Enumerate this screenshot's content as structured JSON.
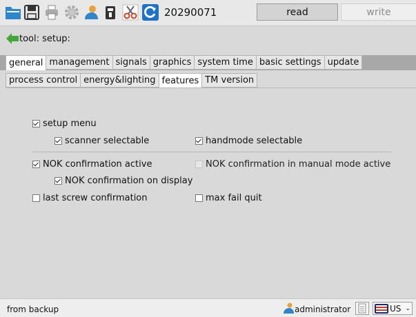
{
  "toolbar": {
    "counter": "20290071",
    "read_label": "read",
    "write_label": "write",
    "icons": [
      "folder-icon",
      "save-icon",
      "printer-icon",
      "gear-icon",
      "user-icon",
      "battery-icon",
      "scissors-icon",
      "refresh-icon"
    ]
  },
  "header": {
    "tool_label": "tool: setup:"
  },
  "tabs_primary": [
    "general",
    "management",
    "signals",
    "graphics",
    "system time",
    "basic settings",
    "update"
  ],
  "tabs_primary_active": "general",
  "tabs_secondary": [
    "process control",
    "energy&lighting",
    "features",
    "TM version"
  ],
  "tabs_secondary_active": "features",
  "options": {
    "setup_menu": {
      "label": "setup menu",
      "checked": true
    },
    "scanner_selectable": {
      "label": "scanner selectable",
      "checked": true
    },
    "handmode_selectable": {
      "label": "handmode selectable",
      "checked": true
    },
    "nok_confirmation_active": {
      "label": "NOK confirmation active",
      "checked": true
    },
    "nok_manual_mode": {
      "label": "NOK confirmation in manual mode active",
      "checked": false,
      "disabled": true
    },
    "nok_on_display": {
      "label": "NOK confirmation on display",
      "checked": true
    },
    "last_screw_confirmation": {
      "label": "last screw confirmation",
      "checked": false
    },
    "max_fail_quit": {
      "label": "max fail quit",
      "checked": false
    }
  },
  "status": {
    "text": "from backup",
    "user": "administrator",
    "language": "US"
  },
  "colors": {
    "accent_blue": "#1e73c8",
    "arrow_green": "#43a63a",
    "flag_red": "#c0392b"
  }
}
